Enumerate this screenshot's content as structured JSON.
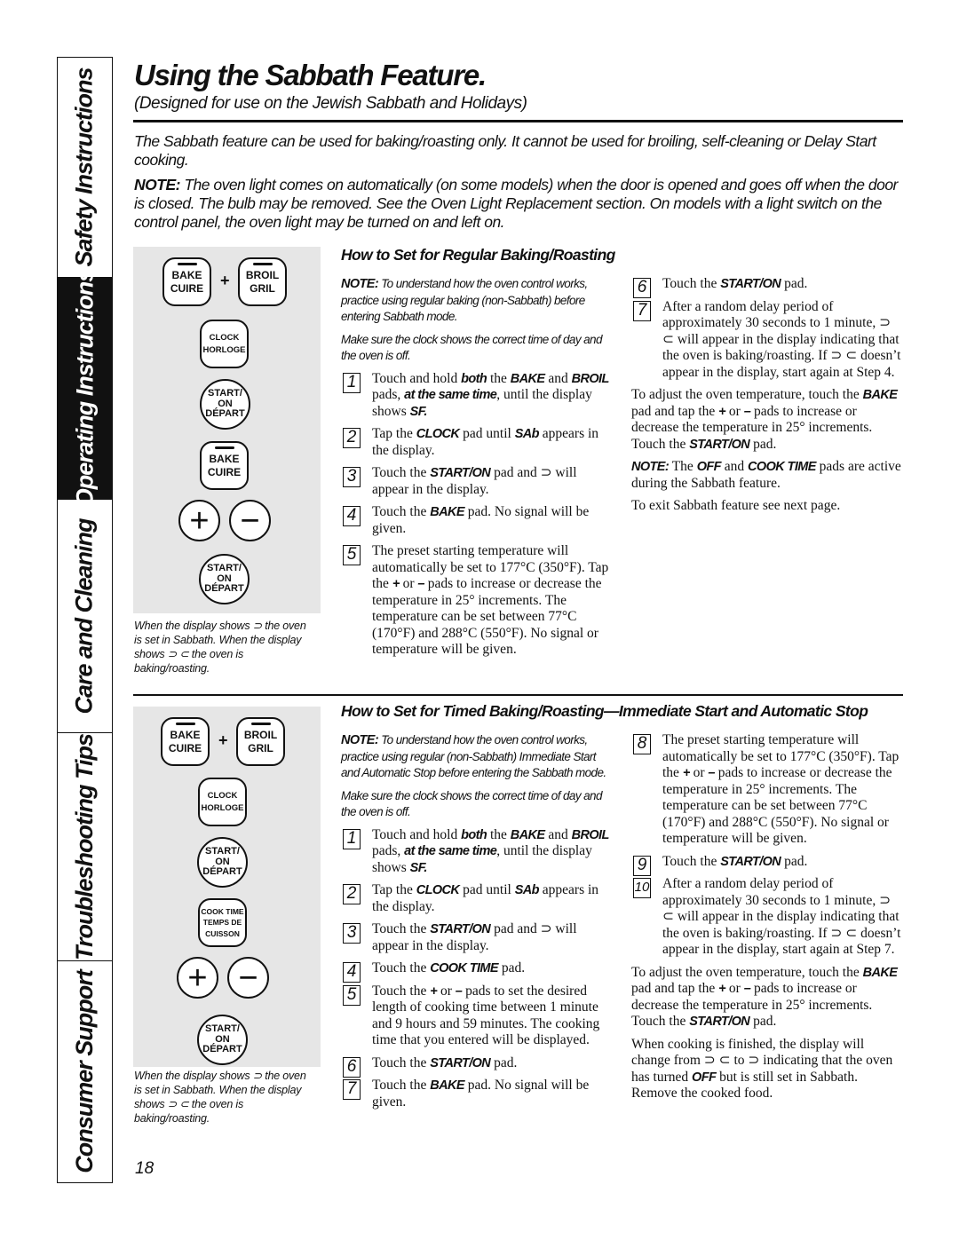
{
  "sidebar": {
    "tabs": [
      {
        "label": "Safety Instructions",
        "active": false
      },
      {
        "label": "Operating Instructions",
        "active": true
      },
      {
        "label": "Care and Cleaning",
        "active": false
      },
      {
        "label": "Troubleshooting Tips",
        "active": false
      },
      {
        "label": "Consumer Support",
        "active": false
      }
    ]
  },
  "header": {
    "title": "Using the Sabbath Feature.",
    "subtitle": "(Designed for use on the Jewish Sabbath and Holidays)"
  },
  "intro": {
    "text": "The Sabbath feature can be used for baking/roasting only. It cannot be used for broiling, self-cleaning or Delay Start cooking.",
    "note_label": "NOTE:",
    "note_text": " The oven light comes on automatically (on some models) when the door is opened and goes off when the door is closed. The bulb may be removed. See the Oven Light Replacement section. On models with a light switch on the control panel, the oven light may be turned on and left on."
  },
  "keypad": {
    "bake": [
      "BAKE",
      "CUIRE"
    ],
    "broil": [
      "BROIL",
      "GRIL"
    ],
    "clock": [
      "CLOCK",
      "HORLOGE"
    ],
    "start": [
      "START/",
      "ON",
      "DÉPART"
    ],
    "cook_time": [
      "COOK TIME",
      "TEMPS DE",
      "CUISSON"
    ],
    "plus": "+",
    "minus": "−",
    "combine": "+"
  },
  "caption": "When the display shows ⊃ the oven is set in Sabbath. When the display shows ⊃ ⊂ the oven is baking/roasting.",
  "section1": {
    "heading": "How to Set for Regular Baking/Roasting",
    "left": [
      {
        "type": "note",
        "segs": [
          {
            "t": "NOTE:",
            "k": 1
          },
          {
            "t": " To understand how the oven control works, practice using regular baking (non-Sabbath) before entering Sabbath mode."
          }
        ]
      },
      {
        "type": "note",
        "segs": [
          {
            "t": "Make sure the clock shows the correct time of day and the oven is off."
          }
        ]
      },
      {
        "type": "step",
        "n": "1",
        "segs": [
          {
            "t": "Touch and hold "
          },
          {
            "t": "both",
            "k": 1
          },
          {
            "t": " the "
          },
          {
            "t": "BAKE",
            "k": 1
          },
          {
            "t": " and "
          },
          {
            "t": "BROIL",
            "k": 1
          },
          {
            "t": " pads, "
          },
          {
            "t": "at the same time",
            "k": 1
          },
          {
            "t": ", until the display shows "
          },
          {
            "t": "SF.",
            "k": 1
          }
        ]
      },
      {
        "type": "step",
        "n": "2",
        "segs": [
          {
            "t": "Tap the "
          },
          {
            "t": "CLOCK",
            "k": 1
          },
          {
            "t": " pad until "
          },
          {
            "t": "SAb",
            "k": 1
          },
          {
            "t": " appears in the display."
          }
        ]
      },
      {
        "type": "step",
        "n": "3",
        "segs": [
          {
            "t": "Touch the "
          },
          {
            "t": "START/ON",
            "k": 1
          },
          {
            "t": " pad and ⊃ will appear in the display."
          }
        ]
      },
      {
        "type": "step",
        "n": "4",
        "segs": [
          {
            "t": "Touch the "
          },
          {
            "t": "BAKE",
            "k": 1
          },
          {
            "t": " pad. No signal will be given."
          }
        ]
      },
      {
        "type": "step",
        "n": "5",
        "segs": [
          {
            "t": "The preset starting temperature will automatically be set to 177°C (350°F). Tap the "
          },
          {
            "t": "+",
            "k": 1
          },
          {
            "t": " or "
          },
          {
            "t": "–",
            "k": 1
          },
          {
            "t": " pads to increase or decrease the temperature in 25° increments. The temperature can be set between 77°C (170°F) and 288°C (550°F). No signal or temperature will be given."
          }
        ]
      }
    ],
    "right": [
      {
        "type": "step",
        "n": "6",
        "segs": [
          {
            "t": "Touch the "
          },
          {
            "t": "START/ON",
            "k": 1
          },
          {
            "t": " pad."
          }
        ]
      },
      {
        "type": "step",
        "n": "7",
        "segs": [
          {
            "t": "After a random delay period of approximately 30 seconds to 1 minute, ⊃ ⊂ will appear in the display indicating that the oven is baking/roasting. If ⊃ ⊂ doesn’t appear in the display, start again at Step 4."
          }
        ]
      },
      {
        "type": "para",
        "segs": [
          {
            "t": "To adjust the oven temperature, touch the "
          },
          {
            "t": "BAKE",
            "k": 1
          },
          {
            "t": " pad and tap the "
          },
          {
            "t": "+",
            "k": 1
          },
          {
            "t": " or "
          },
          {
            "t": "–",
            "k": 1
          },
          {
            "t": " pads to increase or decrease the temperature in 25° increments. Touch the "
          },
          {
            "t": "START/ON",
            "k": 1
          },
          {
            "t": " pad."
          }
        ]
      },
      {
        "type": "para",
        "segs": [
          {
            "t": "NOTE:",
            "k": 1
          },
          {
            "t": " The "
          },
          {
            "t": "OFF",
            "k": 1
          },
          {
            "t": " and "
          },
          {
            "t": "COOK TIME",
            "k": 1
          },
          {
            "t": " pads are active during the Sabbath feature."
          }
        ]
      },
      {
        "type": "para",
        "segs": [
          {
            "t": "To exit Sabbath feature see next page."
          }
        ]
      }
    ]
  },
  "section2": {
    "heading": "How to Set for Timed Baking/Roasting—Immediate Start and Automatic Stop",
    "left": [
      {
        "type": "note",
        "segs": [
          {
            "t": "NOTE:",
            "k": 1
          },
          {
            "t": " To understand how the oven control works, practice using regular (non-Sabbath) Immediate Start and Automatic Stop before entering the Sabbath mode."
          }
        ]
      },
      {
        "type": "note",
        "segs": [
          {
            "t": "Make sure the clock shows the correct time of day and the oven is off."
          }
        ]
      },
      {
        "type": "step",
        "n": "1",
        "segs": [
          {
            "t": "Touch and hold "
          },
          {
            "t": "both",
            "k": 1
          },
          {
            "t": " the "
          },
          {
            "t": "BAKE",
            "k": 1
          },
          {
            "t": " and "
          },
          {
            "t": "BROIL",
            "k": 1
          },
          {
            "t": " pads, "
          },
          {
            "t": "at the same time",
            "k": 1
          },
          {
            "t": ", until the display shows "
          },
          {
            "t": "SF.",
            "k": 1
          }
        ]
      },
      {
        "type": "step",
        "n": "2",
        "segs": [
          {
            "t": "Tap the "
          },
          {
            "t": "CLOCK",
            "k": 1
          },
          {
            "t": " pad until "
          },
          {
            "t": "SAb",
            "k": 1
          },
          {
            "t": " appears in the display."
          }
        ]
      },
      {
        "type": "step",
        "n": "3",
        "segs": [
          {
            "t": "Touch the "
          },
          {
            "t": "START/ON",
            "k": 1
          },
          {
            "t": " pad and ⊃ will appear in the display."
          }
        ]
      },
      {
        "type": "step",
        "n": "4",
        "segs": [
          {
            "t": "Touch the "
          },
          {
            "t": "COOK TIME",
            "k": 1
          },
          {
            "t": " pad."
          }
        ]
      },
      {
        "type": "step",
        "n": "5",
        "segs": [
          {
            "t": "Touch the "
          },
          {
            "t": "+",
            "k": 1
          },
          {
            "t": " or "
          },
          {
            "t": "–",
            "k": 1
          },
          {
            "t": " pads to set the desired length of cooking time between 1 minute and 9 hours and 59 minutes. The cooking time that you entered will be displayed."
          }
        ]
      },
      {
        "type": "step",
        "n": "6",
        "segs": [
          {
            "t": "Touch the "
          },
          {
            "t": "START/ON",
            "k": 1
          },
          {
            "t": " pad."
          }
        ]
      },
      {
        "type": "step",
        "n": "7",
        "segs": [
          {
            "t": "Touch the "
          },
          {
            "t": "BAKE",
            "k": 1
          },
          {
            "t": " pad. No signal will be given."
          }
        ]
      }
    ],
    "right": [
      {
        "type": "step",
        "n": "8",
        "segs": [
          {
            "t": "The preset starting temperature will automatically be set to 177°C (350°F). Tap the "
          },
          {
            "t": "+",
            "k": 1
          },
          {
            "t": " or "
          },
          {
            "t": "–",
            "k": 1
          },
          {
            "t": " pads to increase or decrease the temperature in 25° increments. The temperature can be set between 77°C (170°F) and 288°C (550°F). No signal or temperature will be given."
          }
        ]
      },
      {
        "type": "step",
        "n": "9",
        "segs": [
          {
            "t": "Touch the "
          },
          {
            "t": "START/ON",
            "k": 1
          },
          {
            "t": " pad."
          }
        ]
      },
      {
        "type": "step",
        "n": "10",
        "segs": [
          {
            "t": "After a random delay period of approximately 30 seconds to 1 minute, ⊃ ⊂ will appear in the display indicating that the oven is baking/roasting. If ⊃ ⊂ doesn’t appear in the display, start again at Step 7."
          }
        ]
      },
      {
        "type": "para",
        "segs": [
          {
            "t": "To adjust the oven temperature, touch the "
          },
          {
            "t": "BAKE",
            "k": 1
          },
          {
            "t": " pad and tap the "
          },
          {
            "t": "+",
            "k": 1
          },
          {
            "t": " or "
          },
          {
            "t": "–",
            "k": 1
          },
          {
            "t": " pads to increase or decrease the temperature in 25° increments. Touch the "
          },
          {
            "t": "START/ON",
            "k": 1
          },
          {
            "t": " pad."
          }
        ]
      },
      {
        "type": "para",
        "segs": [
          {
            "t": "When cooking is finished, the display will change from ⊃ ⊂ to ⊃ indicating that the oven has turned "
          },
          {
            "t": "OFF",
            "k": 1
          },
          {
            "t": " but is still set in Sabbath. Remove the cooked food."
          }
        ]
      }
    ]
  },
  "page_number": "18"
}
